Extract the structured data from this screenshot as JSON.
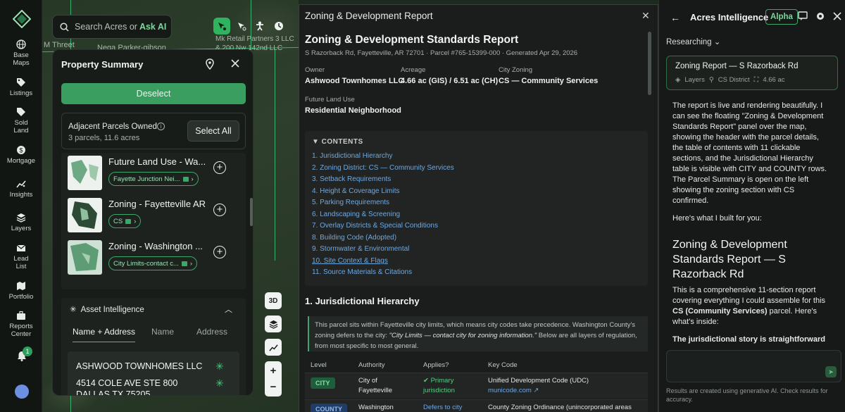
{
  "rail": {
    "items": [
      {
        "label": "Base Maps",
        "icon": "globe-icon"
      },
      {
        "label": "Listings",
        "icon": "tag-icon"
      },
      {
        "label": "Sold Land",
        "icon": "tag-sold-icon"
      },
      {
        "label": "Mortgage",
        "icon": "dollar-icon"
      },
      {
        "label": "Insights",
        "icon": "sparkle-chart-icon"
      },
      {
        "label": "Layers",
        "icon": "layers-icon"
      },
      {
        "label": "Lead List",
        "icon": "envelope-icon"
      },
      {
        "label": "Portfolio",
        "icon": "map-icon"
      },
      {
        "label": "Reports Center",
        "icon": "briefcase-icon"
      }
    ],
    "notification_count": "1"
  },
  "map": {
    "labels": [
      "M Threet",
      "Nega Parker-gibson",
      "Mk Retail Partners 3 LLC",
      "& 200 Nw 142nd LLC"
    ]
  },
  "search": {
    "placeholder": "Search Acres or",
    "ask": "Ask AI"
  },
  "property_summary": {
    "title": "Property Summary",
    "deselect": "Deselect",
    "adjacent_title": "Adjacent Parcels Owned",
    "adjacent_sub": "3 parcels, 11.6 acres",
    "select_all": "Select All",
    "layers": [
      {
        "name": "Future Land Use - Wa...",
        "chip": "Fayette Junction Nei..."
      },
      {
        "name": "Zoning - Fayetteville AR",
        "chip": "CS"
      },
      {
        "name": "Zoning - Washington ...",
        "chip": "City Limits-contact c..."
      }
    ],
    "asset_title": "Asset Intelligence",
    "tabs": [
      "Name + Address",
      "Name",
      "Address"
    ],
    "owner": {
      "name": "ASHWOOD TOWNHOMES LLC",
      "addr1": "4514 COLE AVE STE 800",
      "addr2": "DALLAS TX 75205"
    }
  },
  "map_controls": {
    "threed": "3D"
  },
  "report": {
    "window_title": "Zoning & Development Report",
    "title": "Zoning & Development Standards Report",
    "subtitle": "S Razorback Rd, Fayetteville, AR 72701 · Parcel #765-15399-000 · Generated Apr 29, 2026",
    "fields": [
      {
        "label": "Owner",
        "value": "Ashwood Townhomes LLC"
      },
      {
        "label": "Acreage",
        "value": "4.66 ac (GIS) / 6.51 ac (CH)"
      },
      {
        "label": "City Zoning",
        "value": "CS — Community Services"
      },
      {
        "label": "Future Land Use",
        "value": "Residential Neighborhood"
      }
    ],
    "toc_header": "▼ CONTENTS",
    "toc": [
      "1. Jurisdictional Hierarchy",
      "2. Zoning District: CS — Community Services",
      "3. Setback Requirements",
      "4. Height & Coverage Limits",
      "5. Parking Requirements",
      "6. Landscaping & Screening",
      "7. Overlay Districts & Special Conditions",
      "8. Building Code (Adopted)",
      "9. Stormwater & Environmental",
      "10. Site Context & Flags",
      "11. Source Materials & Citations"
    ],
    "section1_title": "1. Jurisdictional Hierarchy",
    "callout_a": "This parcel sits within Fayetteville city limits, which means city codes take precedence. Washington County's zoning defers to the city: ",
    "callout_quote": "\"City Limits — contact city for zoning information.\"",
    "callout_b": " Below are all layers of regulation, from most specific to most general.",
    "table_headers": [
      "Level",
      "Authority",
      "Applies?",
      "Key Code"
    ],
    "rows": [
      {
        "level": "CITY",
        "authority_1": "City of",
        "authority_2": "Fayetteville",
        "applies_1": "✔ Primary",
        "applies_2": "jurisdiction",
        "code": "Unified Development Code (UDC)",
        "link": "municode.com ↗"
      },
      {
        "level": "COUNTY",
        "authority_1": "Washington",
        "applies_1": "Defers to city",
        "code": "County Zoning Ordinance (unincorporated areas"
      }
    ]
  },
  "ai": {
    "title": "Acres Intelligence",
    "alpha": "Alpha",
    "status": "Researching",
    "card_title": "Zoning Report — S Razorback Rd",
    "card_meta": [
      "Layers",
      "CS District",
      "4.66 ac"
    ],
    "p1": "The report is live and rendering beautifully. I can see the floating \"Zoning & Development Standards Report\" panel over the map, showing the header with the parcel details, the table of contents with 11 clickable sections, and the Jurisdictional Hierarchy table is visible with CITY and COUNTY rows. The Parcel Summary is open on the left showing the zoning section with CS confirmed.",
    "p2": "Here's what I built for you:",
    "heading": "Zoning & Development Standards Report — S Razorback Rd",
    "p3a": "This is a comprehensive 11-section report covering everything I could assemble for this ",
    "p3b": "CS (Community Services)",
    "p3c": " parcel. Here's what's inside:",
    "p4": "The jurisdictional story is straightforward",
    "disclaimer": "Results are created using generative AI. Check results for accuracy."
  }
}
